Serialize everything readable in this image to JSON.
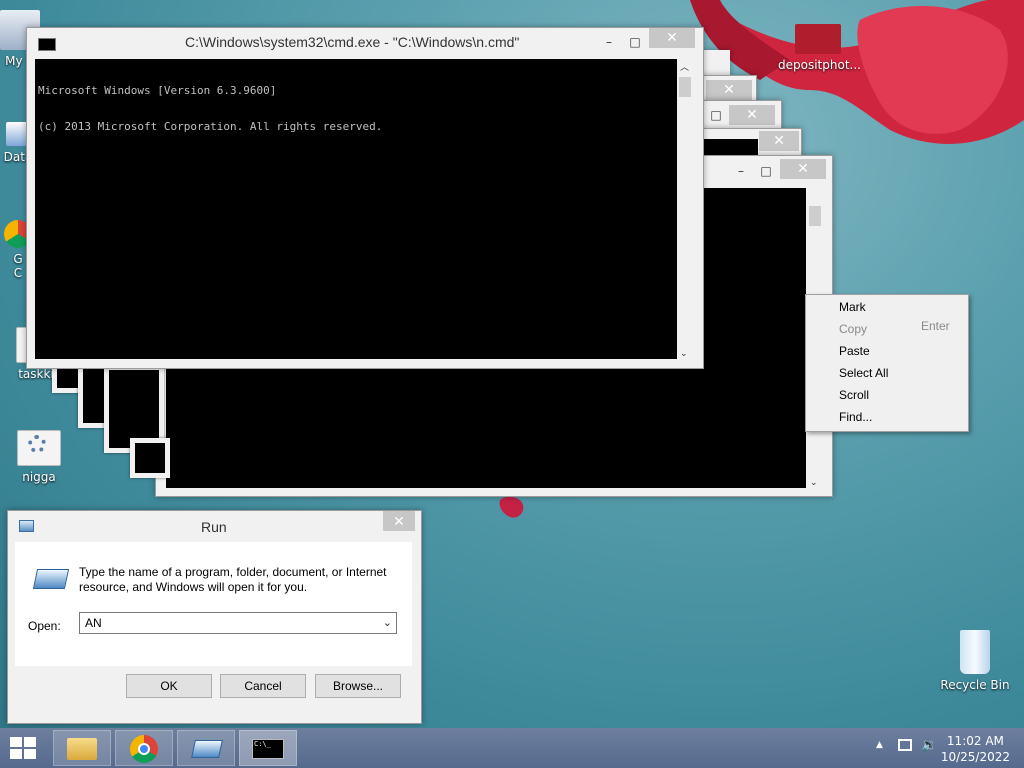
{
  "desktop": {
    "icons": [
      {
        "label": "My C",
        "name": "my-computer"
      },
      {
        "label": "Data",
        "name": "data"
      },
      {
        "label": "G\nC",
        "name": "google-chrome"
      },
      {
        "label": "taskki",
        "name": "taskki"
      },
      {
        "label": "nigga",
        "name": "nigga"
      },
      {
        "label": "depositphot...",
        "name": "depositphotos"
      },
      {
        "label": "Recycle Bin",
        "name": "recycle-bin"
      }
    ]
  },
  "cmd": {
    "title": "C:\\Windows\\system32\\cmd.exe - \"C:\\Windows\\n.cmd\"",
    "line1": "Microsoft Windows [Version 6.3.9600]",
    "line2": "(c) 2013 Microsoft Corporation. All rights reserved.",
    "minimize": "–",
    "maximize": "□",
    "close": "✕"
  },
  "context_menu": {
    "items": [
      "Mark",
      "Copy",
      "Paste",
      "Select All",
      "Scroll",
      "Find..."
    ],
    "copy_shortcut": "Enter"
  },
  "run": {
    "title": "Run",
    "description": "Type the name of a program, folder, document, or Internet resource, and Windows will open it for you.",
    "open_label": "Open:",
    "input_value": "AN",
    "ok": "OK",
    "cancel": "Cancel",
    "browse": "Browse..."
  },
  "taskbar": {
    "time": "11:02 AM",
    "date": "10/25/2022"
  },
  "colors": {
    "desktop_bg": "#4a93a3",
    "console_bg": "#000000",
    "console_text": "#c0c0c0",
    "taskbar": "#5b6f92",
    "close_button": "#c7c7c7"
  }
}
